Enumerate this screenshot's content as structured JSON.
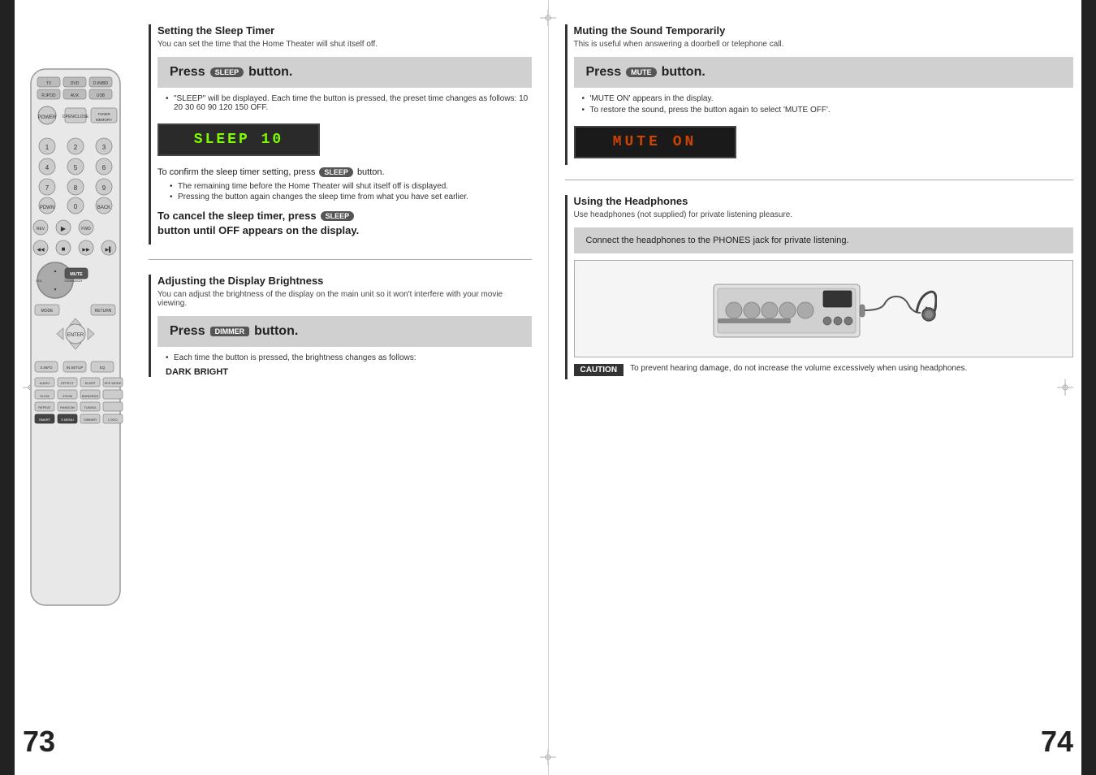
{
  "pages": {
    "left": {
      "page_number": "73",
      "sections": {
        "sleep_timer": {
          "title": "Setting the Sleep Timer",
          "subtitle": "You can set the time that the Home Theater will shut itself off.",
          "instruction": {
            "press": "Press",
            "button_label": "SLEEP",
            "button_text": "button."
          },
          "bullets": [
            "\"SLEEP\" will be displayed. Each time the button is pressed, the preset time changes as follows: 10   20   30   60   90   120   150   OFF."
          ],
          "lcd_text": "SLEEP    10",
          "confirm": {
            "text_before": "To confirm the sleep timer setting, press",
            "button_label": "SLEEP",
            "text_after": "button.",
            "sub_bullets": [
              "The remaining time before the Home Theater will shut itself off is displayed.",
              "Pressing the button again changes the sleep time from what you have set earlier."
            ]
          },
          "cancel": {
            "text_before": "To cancel the sleep timer, press",
            "button_label": "SLEEP",
            "text_after": "button until OFF appears on the display."
          }
        },
        "display_dimmer": {
          "title": "Adjusting the Display Brightness",
          "subtitle": "You can adjust the brightness of the display on the main unit so it won't interfere with your movie viewing.",
          "instruction": {
            "press": "Press",
            "button_label": "DIMMER",
            "button_text": "button."
          },
          "bullets": [
            "Each time the button is pressed, the brightness changes as follows:"
          ],
          "brightness_values": "DARK    BRIGHT"
        }
      }
    },
    "right": {
      "page_number": "74",
      "sections": {
        "mute": {
          "title": "Muting the Sound Temporarily",
          "subtitle": "This is useful when answering a doorbell or telephone call.",
          "instruction": {
            "press": "Press",
            "button_label": "MUTE",
            "button_text": "button."
          },
          "bullets": [
            "'MUTE ON' appears in the display.",
            "To restore the sound, press the button again to select 'MUTE OFF'."
          ],
          "lcd_text": "MUTE  ON"
        },
        "headphones": {
          "title": "Using the Headphones",
          "subtitle": "Use headphones (not supplied) for private listening pleasure.",
          "instruction_text": "Connect the headphones to the PHONES jack for private listening.",
          "caution_label": "CAUTION",
          "caution_text": "To prevent hearing damage, do not increase the volume excessively when using headphones."
        }
      }
    }
  }
}
